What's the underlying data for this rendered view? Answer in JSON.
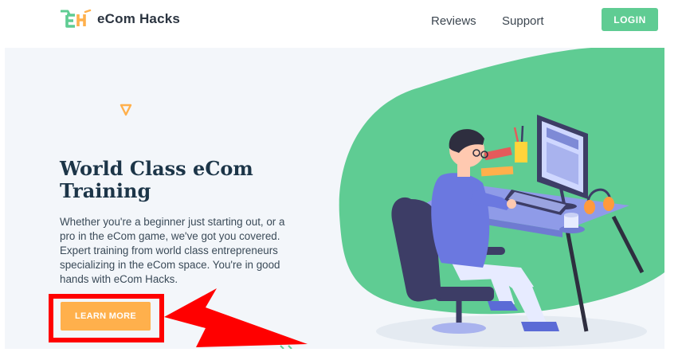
{
  "header": {
    "brand": "eCom Hacks",
    "logo_icon": "cart-eh-logo",
    "nav": {
      "reviews": "Reviews",
      "support": "Support"
    },
    "login_label": "LOGIN"
  },
  "hero": {
    "title_line1": "World Class eCom",
    "title_line2": "Training",
    "description": "Whether you're a beginner just starting out, or a pro in the eCom game, we've got you covered. Expert training from world class entrepreneurs specializing in the eCom space. You're in good hands with eCom Hacks.",
    "cta_label": "LEARN MORE",
    "decor_icon": "triangle-outline",
    "illustration": "person-working-at-computer-desk"
  },
  "annotation": {
    "highlight_color": "#ff0000",
    "points_to": "learn-more-button"
  },
  "colors": {
    "brand_green": "#5fcc93",
    "cta_orange": "#ffb04c",
    "title_navy": "#1c3548",
    "hero_bg": "#f3f6fa"
  }
}
